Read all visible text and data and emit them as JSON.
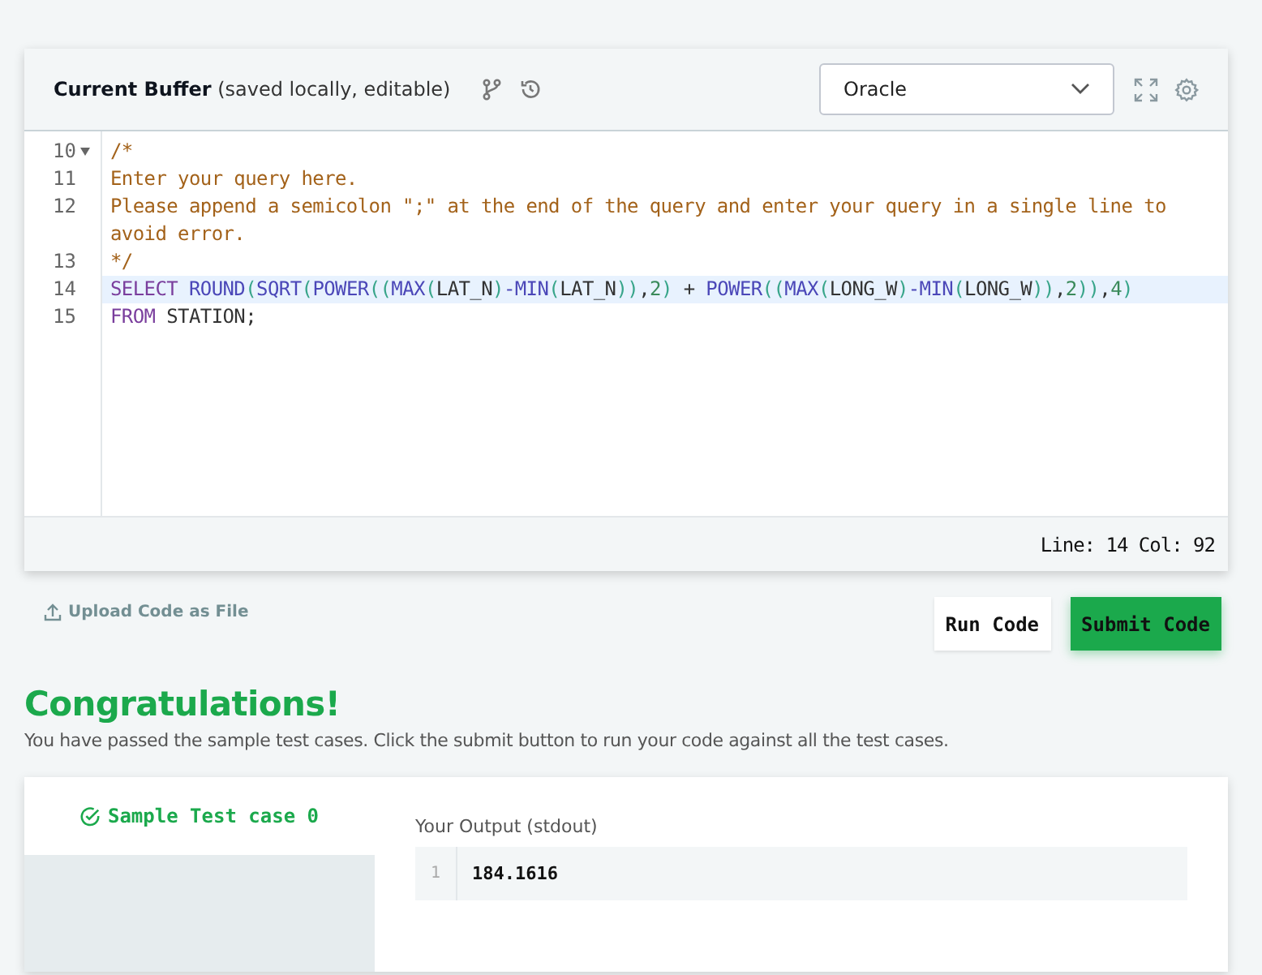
{
  "editor": {
    "title": "Current Buffer",
    "subtitle": "(saved locally, editable)",
    "language": "Oracle",
    "lines": [
      {
        "number": "10",
        "foldable": true,
        "highlighted": false,
        "tokens": [
          {
            "kind": "comment",
            "text": "/*"
          }
        ]
      },
      {
        "number": "11",
        "foldable": false,
        "highlighted": false,
        "tokens": [
          {
            "kind": "comment",
            "text": "Enter your query here."
          }
        ]
      },
      {
        "number": "12",
        "foldable": false,
        "highlighted": false,
        "tokens": [
          {
            "kind": "comment",
            "text": "Please append a semicolon \";\" at the end of the query and enter your query in a single line to avoid error."
          }
        ]
      },
      {
        "number": "13",
        "foldable": false,
        "highlighted": false,
        "tokens": [
          {
            "kind": "comment",
            "text": "*/"
          }
        ]
      },
      {
        "number": "14",
        "foldable": false,
        "highlighted": true,
        "tokens": [
          {
            "kind": "keyword",
            "text": "SELECT "
          },
          {
            "kind": "function",
            "text": "ROUND"
          },
          {
            "kind": "paren",
            "text": "("
          },
          {
            "kind": "function",
            "text": "SQRT"
          },
          {
            "kind": "paren",
            "text": "("
          },
          {
            "kind": "function",
            "text": "POWER"
          },
          {
            "kind": "paren",
            "text": "(("
          },
          {
            "kind": "function",
            "text": "MAX"
          },
          {
            "kind": "paren",
            "text": "("
          },
          {
            "kind": "plain",
            "text": "LAT_N"
          },
          {
            "kind": "paren",
            "text": ")"
          },
          {
            "kind": "function",
            "text": "-MIN"
          },
          {
            "kind": "paren",
            "text": "("
          },
          {
            "kind": "plain",
            "text": "LAT_N"
          },
          {
            "kind": "paren",
            "text": "))"
          },
          {
            "kind": "plain",
            "text": ","
          },
          {
            "kind": "number",
            "text": "2"
          },
          {
            "kind": "paren",
            "text": ")"
          },
          {
            "kind": "plain",
            "text": " + "
          },
          {
            "kind": "function",
            "text": "POWER"
          },
          {
            "kind": "paren",
            "text": "(("
          },
          {
            "kind": "function",
            "text": "MAX"
          },
          {
            "kind": "paren",
            "text": "("
          },
          {
            "kind": "plain",
            "text": "LONG_W"
          },
          {
            "kind": "paren",
            "text": ")"
          },
          {
            "kind": "function",
            "text": "-MIN"
          },
          {
            "kind": "paren",
            "text": "("
          },
          {
            "kind": "plain",
            "text": "LONG_W"
          },
          {
            "kind": "paren",
            "text": "))"
          },
          {
            "kind": "plain",
            "text": ","
          },
          {
            "kind": "number",
            "text": "2"
          },
          {
            "kind": "paren",
            "text": "))"
          },
          {
            "kind": "plain",
            "text": ","
          },
          {
            "kind": "number",
            "text": "4"
          },
          {
            "kind": "paren",
            "text": ")"
          }
        ]
      },
      {
        "number": "15",
        "foldable": false,
        "highlighted": false,
        "tokens": [
          {
            "kind": "keyword",
            "text": "FROM "
          },
          {
            "kind": "plain",
            "text": "STATION;"
          }
        ]
      }
    ],
    "status": "Line: 14 Col: 92"
  },
  "upload_link": "Upload Code as File",
  "buttons": [
    {
      "label": "Run Code",
      "kind": "secondary"
    },
    {
      "label": "Submit Code",
      "kind": "primary"
    }
  ],
  "result": {
    "title": "Congratulations!",
    "message": "You have passed the sample test cases. Click the submit button to run your code against all the test cases."
  },
  "test_cases": [
    {
      "label": "Sample Test case 0",
      "selected": true,
      "passed": true
    }
  ],
  "output": {
    "label": "Your Output (stdout)",
    "lines": [
      {
        "number": "1",
        "text": "184.1616"
      }
    ]
  }
}
